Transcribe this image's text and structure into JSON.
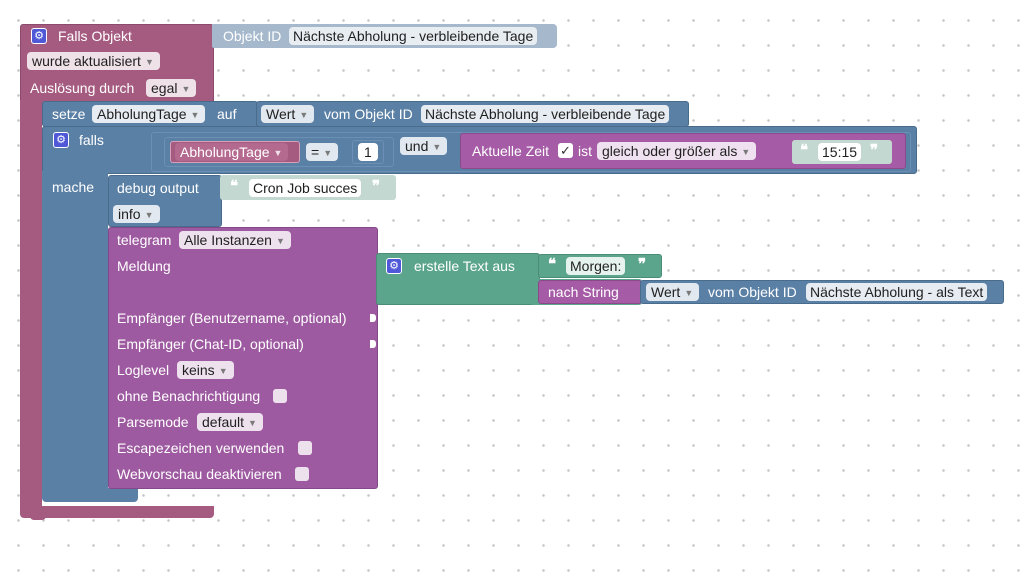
{
  "trigger": {
    "title": "Falls Objekt",
    "object_id_label": "Objekt ID",
    "object_id_value": "Nächste Abholung - verbleibende Tage",
    "updated_option": "wurde aktualisiert",
    "trigger_by_label": "Auslösung durch",
    "trigger_by_value": "egal"
  },
  "set_block": {
    "label": "setze",
    "variable": "AbholungTage",
    "to_label": "auf",
    "value_type": "Wert",
    "from_label": "vom Objekt ID",
    "object_id_value": "Nächste Abholung - verbleibende Tage"
  },
  "if_block": {
    "if_label": "falls",
    "do_label": "mache",
    "compare_var": "AbholungTage",
    "operator": "=",
    "number": "1",
    "logic_op": "und",
    "time_label": "Aktuelle Zeit",
    "time_checked_mark": "✓",
    "is_label": "ist",
    "time_compare": "gleich oder größer als",
    "time_value": "15:15"
  },
  "debug": {
    "label": "debug output",
    "text": "Cron Job succes",
    "level": "info"
  },
  "telegram": {
    "label": "telegram",
    "instance": "Alle Instanzen",
    "message_label": "Meldung",
    "recipient_user_label": "Empfänger (Benutzername, optional)",
    "recipient_chat_label": "Empfänger (Chat-ID, optional)",
    "loglevel_label": "Loglevel",
    "loglevel_value": "keins",
    "silent_label": "ohne Benachrichtigung",
    "parsemode_label": "Parsemode",
    "parsemode_value": "default",
    "escape_label": "Escapezeichen verwenden",
    "preview_label": "Webvorschau deaktivieren"
  },
  "text_join": {
    "label": "erstelle Text aus",
    "text1": "Morgen:",
    "to_string_label": "nach String",
    "value_type": "Wert",
    "from_label": "vom Objekt ID",
    "object_id_value": "Nächste Abholung - als Text"
  },
  "colors": {
    "trigger": "#a55b80",
    "logic": "#5b80a5",
    "telegram": "#a55ba5",
    "text": "#5ba58c",
    "gear": "#4f59d8"
  },
  "icons": {
    "gear": "⚙",
    "dropdown": "▼",
    "quote_open": "❝",
    "quote_close": "❞"
  }
}
